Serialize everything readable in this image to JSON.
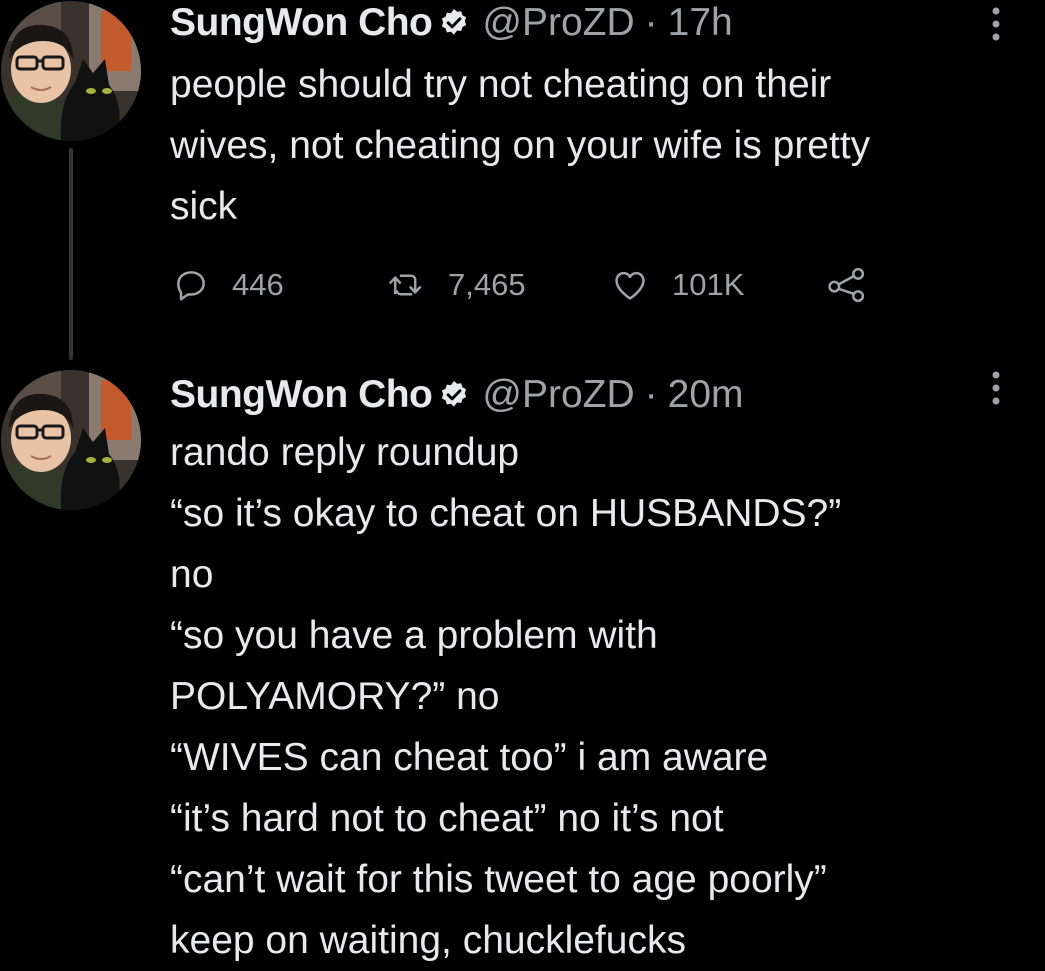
{
  "tweets": [
    {
      "author": {
        "display_name": "SungWon Cho",
        "handle": "@ProZD",
        "verified": true,
        "avatar": "avatar-photo"
      },
      "separator": "·",
      "time": "17h",
      "lines": [
        "people should try not cheating on their",
        "wives, not cheating on your wife is pretty",
        "sick"
      ],
      "actions": {
        "replies": "446",
        "retweets": "7,465",
        "likes": "101K",
        "reply_icon": "reply-icon",
        "retweet_icon": "retweet-icon",
        "like_icon": "heart-icon",
        "share_icon": "share-icon"
      },
      "more_icon": "more-icon"
    },
    {
      "author": {
        "display_name": "SungWon Cho",
        "handle": "@ProZD",
        "verified": true,
        "avatar": "avatar-photo"
      },
      "separator": "·",
      "time": "20m",
      "lines": [
        "rando reply roundup",
        "“so it’s okay to cheat on HUSBANDS?”",
        "no",
        "“so you have a problem with",
        "POLYAMORY?” no",
        "“WIVES can cheat too” i am aware",
        "“it’s hard not to cheat” no it’s not",
        "“can’t wait for this tweet to age poorly”",
        "keep on waiting, chucklefucks"
      ],
      "more_icon": "more-icon"
    }
  ],
  "colors": {
    "background": "#000000",
    "text_primary": "#e7e9ea",
    "text_secondary": "#9ea3a8",
    "verified_badge": "#e7e9ea",
    "thread_line": "#333639"
  }
}
